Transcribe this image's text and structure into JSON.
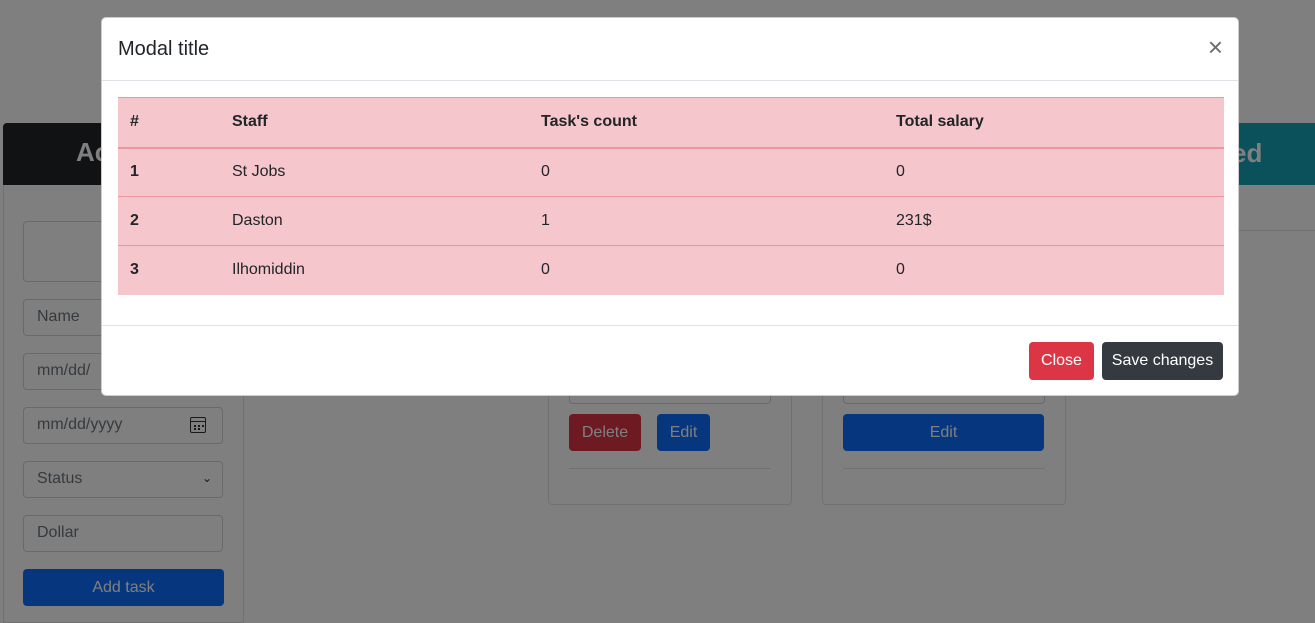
{
  "background": {
    "left_header_text": "Ac",
    "right_header_text": "ed",
    "form": {
      "name_placeholder": "Name",
      "date_placeholder_1": "mm/dd/",
      "date_placeholder_2": "mm/dd/yyyy",
      "status_label": "Status",
      "dollar_placeholder": "Dollar",
      "add_task_label": "Add task"
    },
    "cards": [
      {
        "delete_label": "Delete",
        "edit_label": "Edit"
      },
      {
        "edit_label": "Edit"
      }
    ]
  },
  "modal": {
    "title": "Modal title",
    "close_icon": "×",
    "columns": [
      "#",
      "Staff",
      "Task's count",
      "Total salary"
    ],
    "rows": [
      {
        "num": "1",
        "staff": "St Jobs",
        "tasks": "0",
        "salary": "0"
      },
      {
        "num": "2",
        "staff": "Daston",
        "tasks": "1",
        "salary": "231$"
      },
      {
        "num": "3",
        "staff": "Ilhomiddin",
        "tasks": "0",
        "salary": "0"
      }
    ],
    "close_label": "Close",
    "save_label": "Save changes"
  },
  "colors": {
    "table_bg": "#f5c6cb",
    "danger": "#dc3545",
    "dark": "#343a40",
    "primary": "#0d6efd",
    "info": "#17a2b8"
  }
}
